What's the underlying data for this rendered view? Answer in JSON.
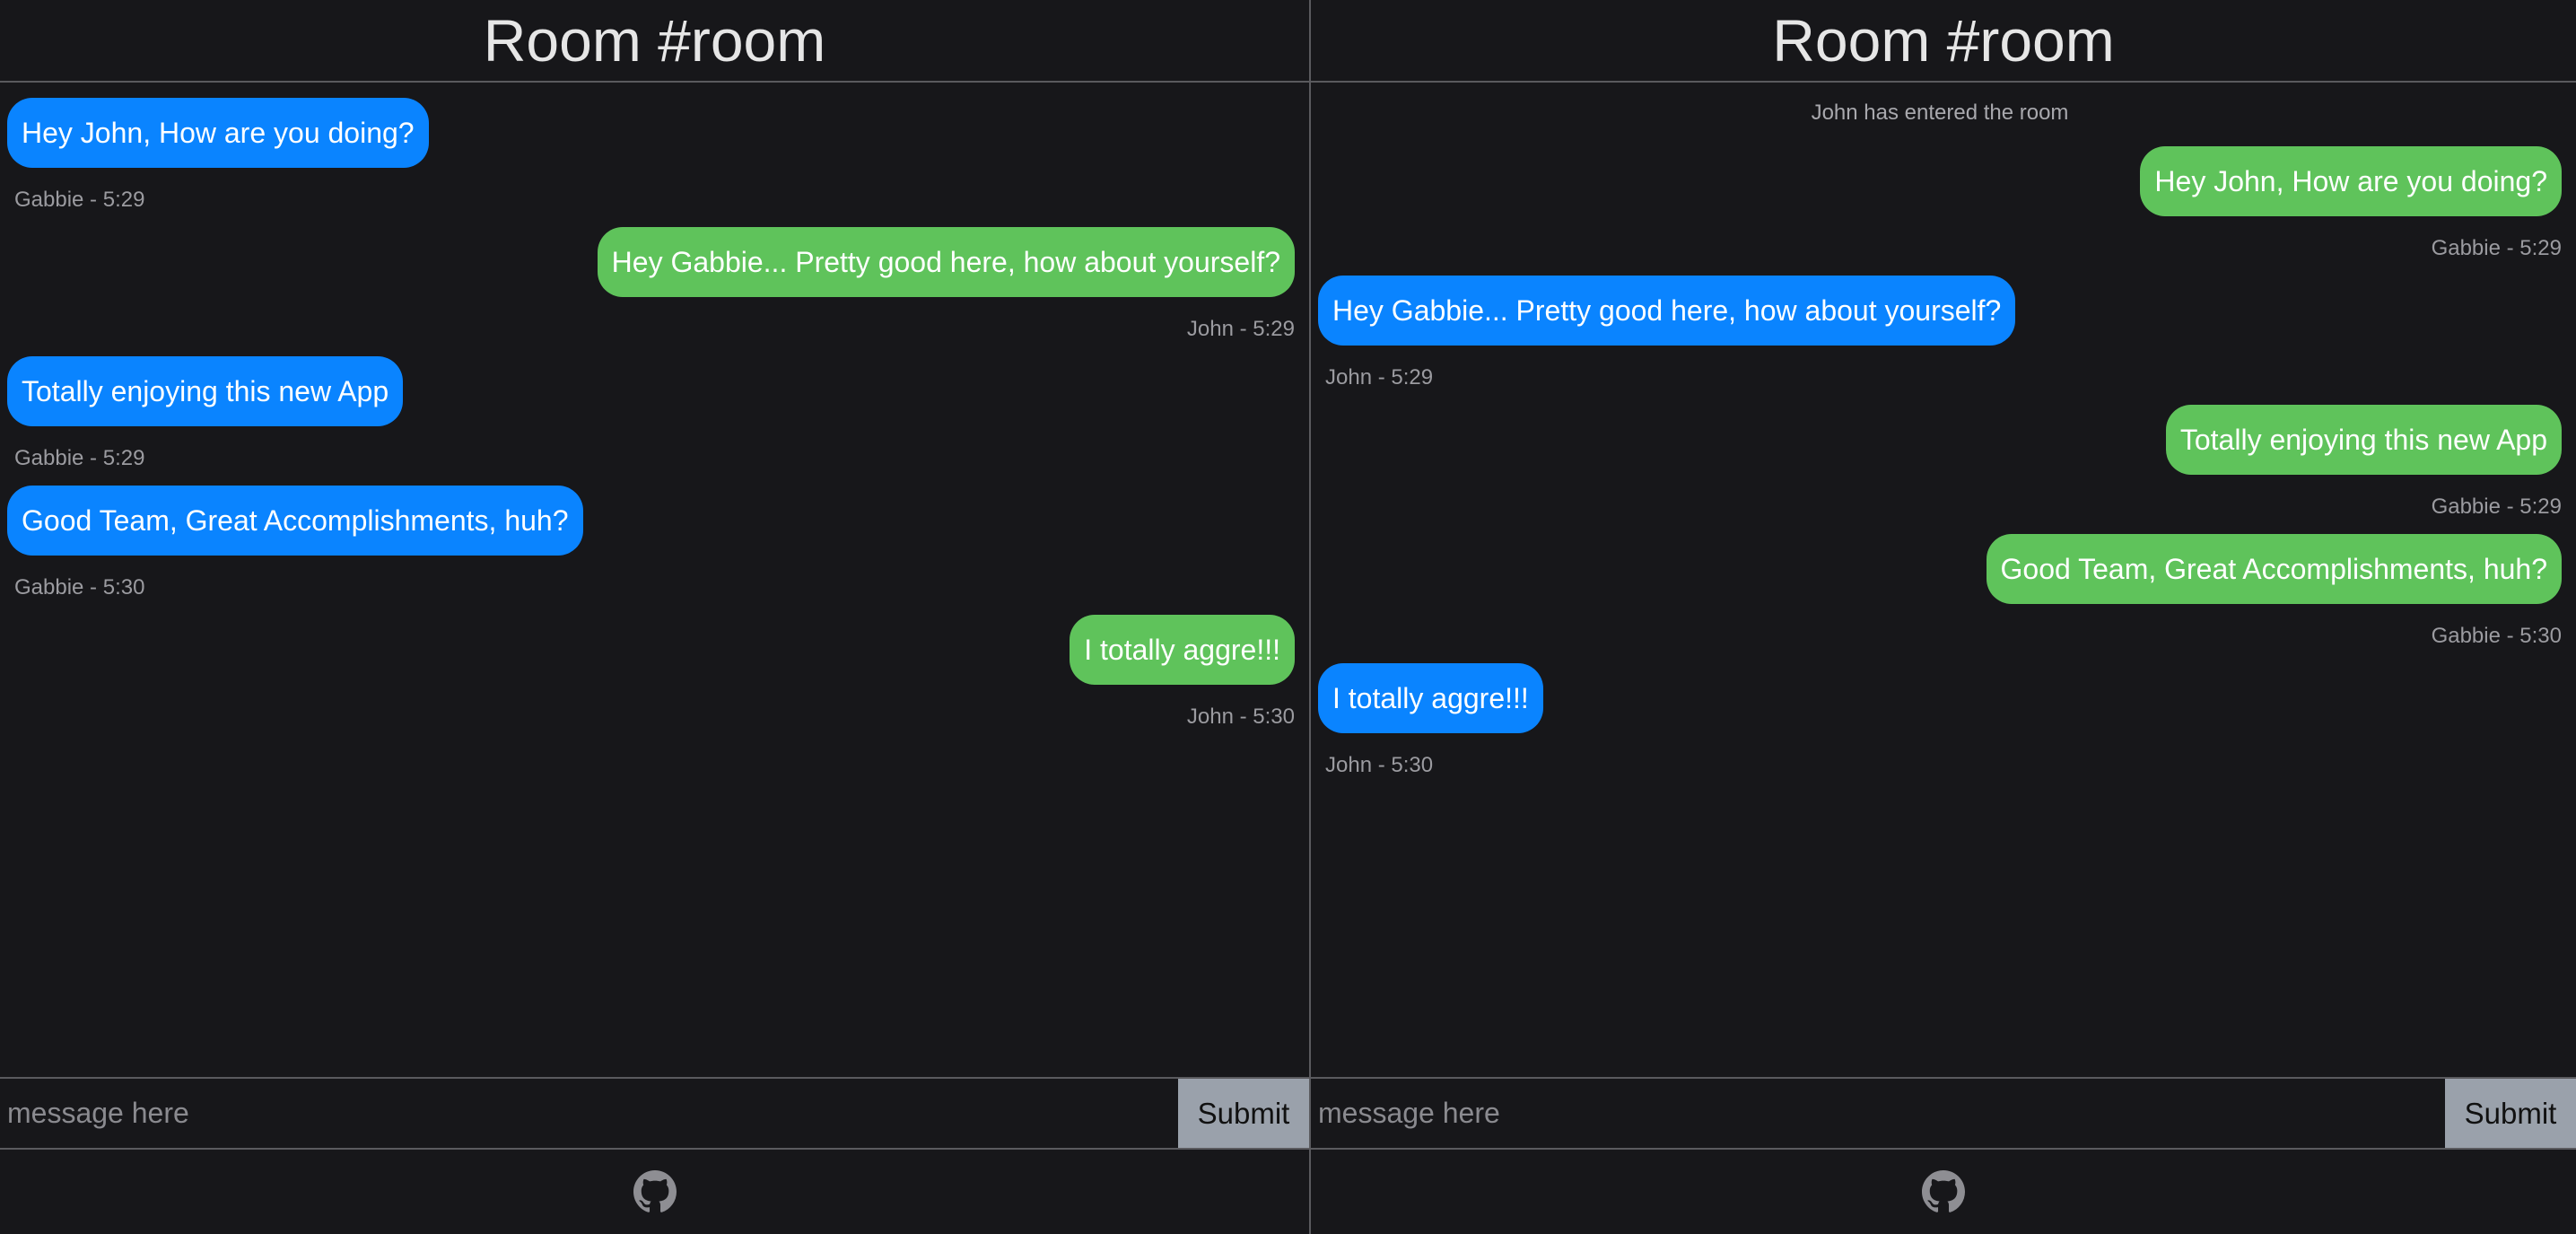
{
  "left": {
    "header": "Room #room",
    "messages": [
      {
        "text": "Hey John, How are you doing?",
        "meta": "Gabbie - 5:29"
      },
      {
        "text": "Hey Gabbie... Pretty good here, how about yourself?",
        "meta": "John - 5:29"
      },
      {
        "text": "Totally enjoying this new App",
        "meta": "Gabbie - 5:29"
      },
      {
        "text": "Good Team, Great Accomplishments, huh?",
        "meta": "Gabbie - 5:30"
      },
      {
        "text": "I totally aggre!!!",
        "meta": "John - 5:30"
      }
    ],
    "input_placeholder": "message here",
    "submit_label": "Submit"
  },
  "right": {
    "header": "Room #room",
    "system_message": "John has entered the room",
    "messages": [
      {
        "text": "Hey John, How are you doing?",
        "meta": "Gabbie - 5:29"
      },
      {
        "text": "Hey Gabbie... Pretty good here, how about yourself?",
        "meta": "John - 5:29"
      },
      {
        "text": "Totally enjoying this new App",
        "meta": "Gabbie - 5:29"
      },
      {
        "text": "Good Team, Great Accomplishments, huh?",
        "meta": "Gabbie - 5:30"
      },
      {
        "text": "I totally aggre!!!",
        "meta": "John - 5:30"
      }
    ],
    "input_placeholder": "message here",
    "submit_label": "Submit"
  },
  "footer": {
    "icon": "github-icon"
  },
  "colors": {
    "background": "#17171a",
    "bubble_blue": "#0a84ff",
    "bubble_green": "#5fc35b",
    "submit_bg": "#9aa1ab"
  }
}
